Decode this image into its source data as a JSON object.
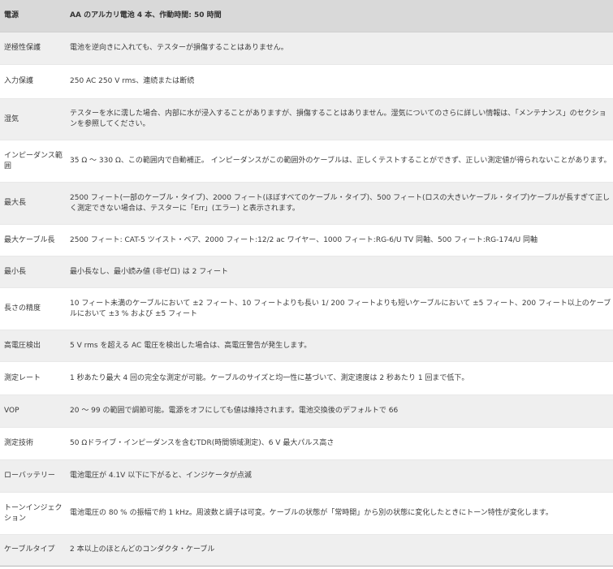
{
  "header": {
    "label": "電源",
    "value": "AA のアルカリ電池 4 本、作動時間: 50 時間"
  },
  "rows": [
    {
      "label": "逆極性保護",
      "value": "電池を逆向きに入れても、テスターが損傷することはありません。"
    },
    {
      "label": "入力保護",
      "value": "250 AC 250 V rms、連続または断続"
    },
    {
      "label": "湿気",
      "value": "テスターを水に濡した場合、内部に水が浸入することがありますが、損傷することはありません。湿気についてのさらに詳しい情報は、「メンテナンス」のセクションを参照してください。"
    },
    {
      "label": "インピーダンス範囲",
      "value": "35 Ω ～ 330 Ω、この範囲内で自動補正。 インピーダンスがこの範囲外のケーブルは、正しくテストすることができず、正しい測定値が得られないことがあります。"
    },
    {
      "label": "最大長",
      "value": "2500 フィート(一部のケーブル・タイプ)、2000 フィート(ほぼすべてのケーブル・タイプ)、500 フィート(ロスの大きいケーブル・タイプ)ケーブルが長すぎて正しく測定できない場合は、テスターに「Err」(エラー) と表示されます。"
    },
    {
      "label": "最大ケーブル長",
      "value": "2500 フィート: CAT-5 ツイスト・ペア、2000 フィート:12/2 ac ワイヤー、1000 フィート:RG-6/U TV 同軸、500 フィート:RG-174/U 同軸"
    },
    {
      "label": "最小長",
      "value": "最小長なし、最小読み値 (非ゼロ) は 2 フィート"
    },
    {
      "label": "長さの精度",
      "value": "10 フィート未満のケーブルにおいて ±2 フィート、10 フィートよりも長い 1/ 200 フィートよりも短いケーブルにおいて ±5 フィート、200 フィート以上のケーブルにおいて ±3 % および ±5 フィート"
    },
    {
      "label": "高電圧検出",
      "value": "5 V rms を超える AC 電圧を検出した場合は、高電圧警告が発生します。"
    },
    {
      "label": "測定レート",
      "value": "1 秒あたり最大 4 回の完全な測定が可能。ケーブルのサイズと均一性に基づいて、測定速度は 2 秒あたり 1 回まで低下。"
    },
    {
      "label": "VOP",
      "value": "20 ～ 99 の範囲で調節可能。電源をオフにしても値は維持されます。電池交換後のデフォルトで 66"
    },
    {
      "label": "測定技術",
      "value": "50 Ωドライブ・インピーダンスを含むTDR(時間領域測定)、6 V 最大パルス高さ"
    },
    {
      "label": "ローバッテリー",
      "value": "電池電圧が 4.1V 以下に下がると、インジケータが点滅"
    },
    {
      "label": "トーンインジェクション",
      "value": "電池電圧の 80 % の振幅で約 1 kHz。周波数と調子は可変。ケーブルの状態が「常時開」から別の状態に変化したときにトーン特性が変化します。"
    },
    {
      "label": "ケーブルタイプ",
      "value": "2 本以上のほとんどのコンダクタ・ケーブル"
    }
  ]
}
